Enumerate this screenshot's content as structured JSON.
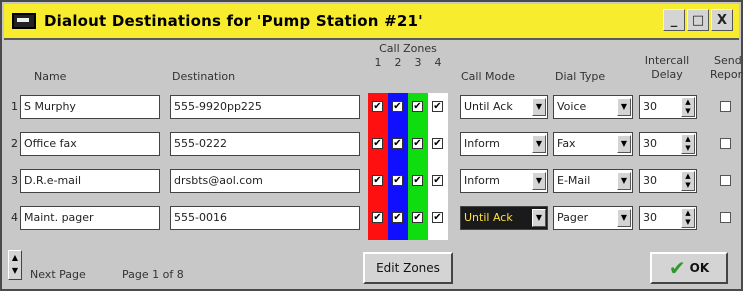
{
  "window": {
    "title": "Dialout Destinations for 'Pump Station #21'",
    "buttons": {
      "minimize": "_",
      "maximize": "□",
      "close": "X"
    }
  },
  "headers": {
    "name": "Name",
    "destination": "Destination",
    "call_zones": "Call Zones",
    "zone_numbers": [
      "1",
      "2",
      "3",
      "4"
    ],
    "call_mode": "Call Mode",
    "dial_type": "Dial Type",
    "intercall_delay_line1": "Intercall",
    "intercall_delay_line2": "Delay",
    "send_report_line1": "Send",
    "send_report_line2": "Repor"
  },
  "zone_colors": [
    "#ff1010",
    "#1010ff",
    "#10dd10",
    "#ffffff"
  ],
  "rows": [
    {
      "num": "1",
      "name": "S Murphy",
      "destination": "555-9920pp225",
      "zones": [
        "✔",
        "✔",
        "✔",
        "✔"
      ],
      "call_mode": "Until Ack",
      "dial_type": "Voice",
      "delay": "30"
    },
    {
      "num": "2",
      "name": "Office fax",
      "destination": "555-0222",
      "zones": [
        "✔",
        "✔",
        "✔",
        "✔"
      ],
      "call_mode": "Inform",
      "dial_type": "Fax",
      "delay": "30"
    },
    {
      "num": "3",
      "name": "D.R.e-mail",
      "destination": "drsbts@aol.com",
      "zones": [
        "✔",
        "✔",
        "✔",
        "✔"
      ],
      "call_mode": "Inform",
      "dial_type": "E-Mail",
      "delay": "30"
    },
    {
      "num": "4",
      "name": "Maint. pager",
      "destination": "555-0016",
      "zones": [
        "✔",
        "✔",
        "✔",
        "✔"
      ],
      "call_mode": "Until Ack",
      "dial_type": "Pager",
      "delay": "30"
    }
  ],
  "footer": {
    "next_page": "Next Page",
    "page_info": "Page 1 of 8",
    "edit_zones": "Edit Zones",
    "ok": "OK",
    "ok_icon": "✔"
  }
}
